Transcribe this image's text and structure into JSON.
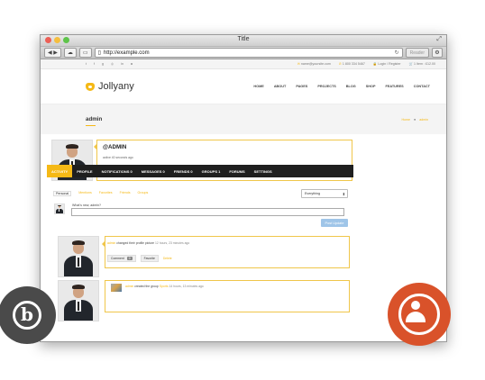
{
  "window": {
    "title": "Title",
    "url": "http://example.com",
    "reader_label": "Reader"
  },
  "topbar": {
    "social_icons": [
      "twitter-icon",
      "facebook-icon",
      "google-plus-icon",
      "dribbble-icon",
      "linkedin-icon",
      "instagram-icon"
    ],
    "email": "name@yoursite.com",
    "phone": "1 800 334 5467",
    "login": "Login / Register",
    "cart": "1 Item : £12.00"
  },
  "header": {
    "logo_text": "Jollyany",
    "nav": [
      "HOME",
      "ABOUT",
      "PAGES",
      "PROJECTS",
      "BLOG",
      "SHOP",
      "FEATURES",
      "CONTACT"
    ]
  },
  "title_band": {
    "title": "admin",
    "crumb_home": "Home",
    "crumb_current": "admin"
  },
  "profile": {
    "handle": "@ADMIN",
    "active": "active 40 seconds ago",
    "blurb": "Duis autem vel eum iriure dolor in hendrerit in vulputate velit esse molestie consequat, vel illum dolore eu feugiat nulla",
    "blurb_link": "View"
  },
  "tabs": [
    {
      "label": "ACTIVITY",
      "active": true
    },
    {
      "label": "PROFILE",
      "active": false
    },
    {
      "label": "NOTIFICATIONS 0",
      "active": false
    },
    {
      "label": "MESSAGES 0",
      "active": false
    },
    {
      "label": "FRIENDS 0",
      "active": false
    },
    {
      "label": "GROUPS 1",
      "active": false
    },
    {
      "label": "FORUMS",
      "active": false
    },
    {
      "label": "SETTINGS",
      "active": false
    }
  ],
  "subtabs": [
    "Personal",
    "Mentions",
    "Favorites",
    "Friends",
    "Groups"
  ],
  "filter": {
    "selected": "Everything"
  },
  "composer": {
    "prompt": "What's new, admin?",
    "post_button": "Post Update"
  },
  "activity1": {
    "user": "admin",
    "action": "changed their profile picture",
    "time": "12 hours, 23 minutes ago",
    "comment_label": "Comment",
    "comment_count": "0",
    "favorite_label": "Favorite",
    "delete_label": "Delete"
  },
  "activity2": {
    "user": "admin",
    "action": "created the group",
    "group": "Sports",
    "time": "14 hours, 13 minutes ago"
  },
  "colors": {
    "accent": "#f5b916",
    "dark_tabs": "#1f1f1f",
    "wordpress_badge": "#4a4a4a",
    "buddypress_badge": "#d9522a"
  }
}
